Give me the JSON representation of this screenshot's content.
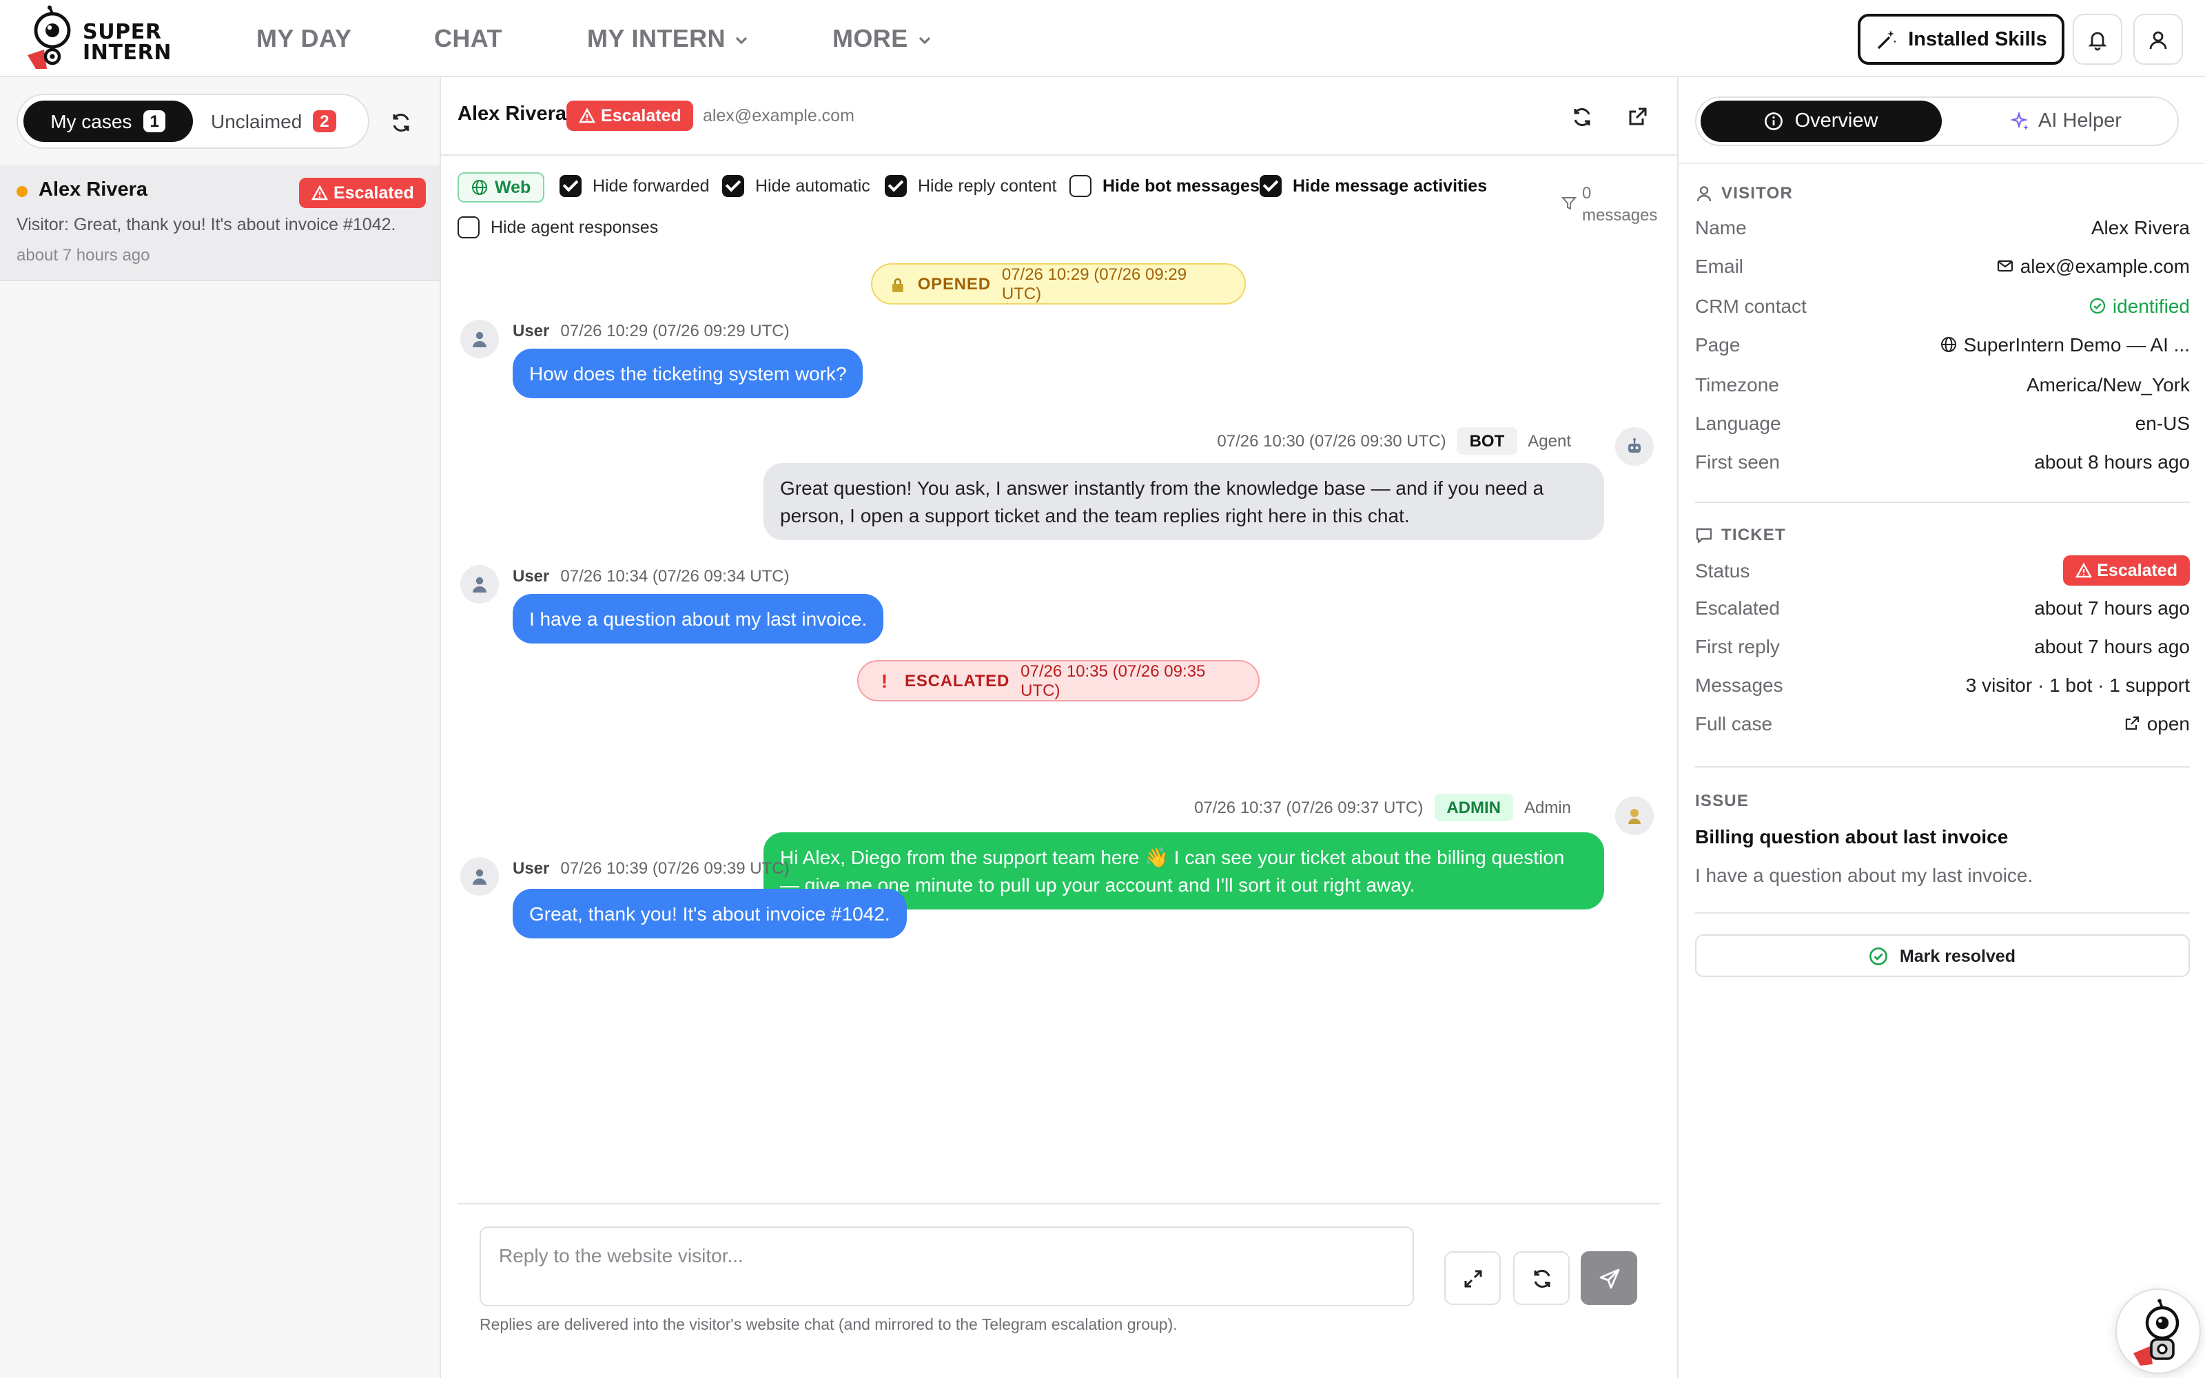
{
  "brand": {
    "line1": "SUPER",
    "line2": "INTERN"
  },
  "nav": {
    "my_day": "MY DAY",
    "chat": "CHAT",
    "my_intern": "MY INTERN",
    "more": "MORE",
    "installed_skills": "Installed Skills"
  },
  "cases": {
    "tab_mine": "My cases",
    "mine_count": "1",
    "tab_unclaimed": "Unclaimed",
    "unclaimed_count": "2",
    "items": [
      {
        "name": "Alex Rivera",
        "status": "Escalated",
        "preview": "Visitor: Great, thank you! It's about invoice #1042.",
        "time": "about 7 hours ago"
      }
    ]
  },
  "chat": {
    "name": "Alex Rivera",
    "status": "Escalated",
    "email": "alex@example.com",
    "channel": "Web",
    "filters": {
      "hide_forwarded": "Hide forwarded",
      "hide_automatic": "Hide automatic",
      "hide_reply_content": "Hide reply content",
      "hide_bot_messages": "Hide bot messages",
      "hide_message_activities": "Hide message activities",
      "hide_agent_responses": "Hide agent responses"
    },
    "message_count_num": "0",
    "message_count_label": "messages",
    "opened": {
      "label": "OPENED",
      "time": "07/26 10:29 (07/26 09:29 UTC)"
    },
    "escalated": {
      "label": "ESCALATED",
      "time": "07/26 10:35 (07/26 09:35 UTC)"
    },
    "messages": [
      {
        "role": "User",
        "time": "07/26 10:29 (07/26 09:29 UTC)",
        "text": "How does the ticketing system work?"
      },
      {
        "role": "Agent",
        "tag": "BOT",
        "time": "07/26 10:30 (07/26 09:30 UTC)",
        "text": "Great question! You ask, I answer instantly from the knowledge base — and if you need a person, I open a support ticket and the team replies right here in this chat."
      },
      {
        "role": "User",
        "time": "07/26 10:34 (07/26 09:34 UTC)",
        "text": "I have a question about my last invoice."
      },
      {
        "role": "Admin",
        "tag": "ADMIN",
        "time": "07/26 10:37 (07/26 09:37 UTC)",
        "text": "Hi Alex, Diego from the support team here 👋  I can see your ticket about the billing question — give me one minute to pull up your account and I'll sort it out right away."
      },
      {
        "role": "User",
        "time": "07/26 10:39 (07/26 09:39 UTC)",
        "text": "Great, thank you! It's about invoice #1042."
      }
    ],
    "reply_placeholder": "Reply to the website visitor...",
    "hint": "Replies are delivered into the visitor's website chat (and mirrored to the Telegram escalation group)."
  },
  "side": {
    "tab_overview": "Overview",
    "tab_ai_helper": "AI Helper",
    "visitor_title": "VISITOR",
    "visitor": [
      {
        "k": "Name",
        "v": "Alex Rivera"
      },
      {
        "k": "Email",
        "v": "alex@example.com"
      },
      {
        "k": "CRM contact",
        "v": "identified"
      },
      {
        "k": "Page",
        "v": "SuperIntern Demo — AI ..."
      },
      {
        "k": "Timezone",
        "v": "America/New_York"
      },
      {
        "k": "Language",
        "v": "en-US"
      },
      {
        "k": "First seen",
        "v": "about 8 hours ago"
      }
    ],
    "ticket_title": "TICKET",
    "ticket": [
      {
        "k": "Status",
        "v": "Escalated"
      },
      {
        "k": "Escalated",
        "v": "about 7 hours ago"
      },
      {
        "k": "First reply",
        "v": "about 7 hours ago"
      },
      {
        "k": "Messages",
        "v": "3 visitor · 1 bot · 1 support"
      },
      {
        "k": "Full case",
        "v": "open"
      }
    ],
    "issue_title": "ISSUE",
    "issue_heading": "Billing question about last invoice",
    "issue_text": "I have a question about my last invoice.",
    "mark_resolved": "Mark resolved"
  },
  "colors": {
    "user_bubble": "#3b82f6",
    "admin_bubble": "#22c55e",
    "escalated": "#ef4444",
    "identified": "#16a34a"
  }
}
